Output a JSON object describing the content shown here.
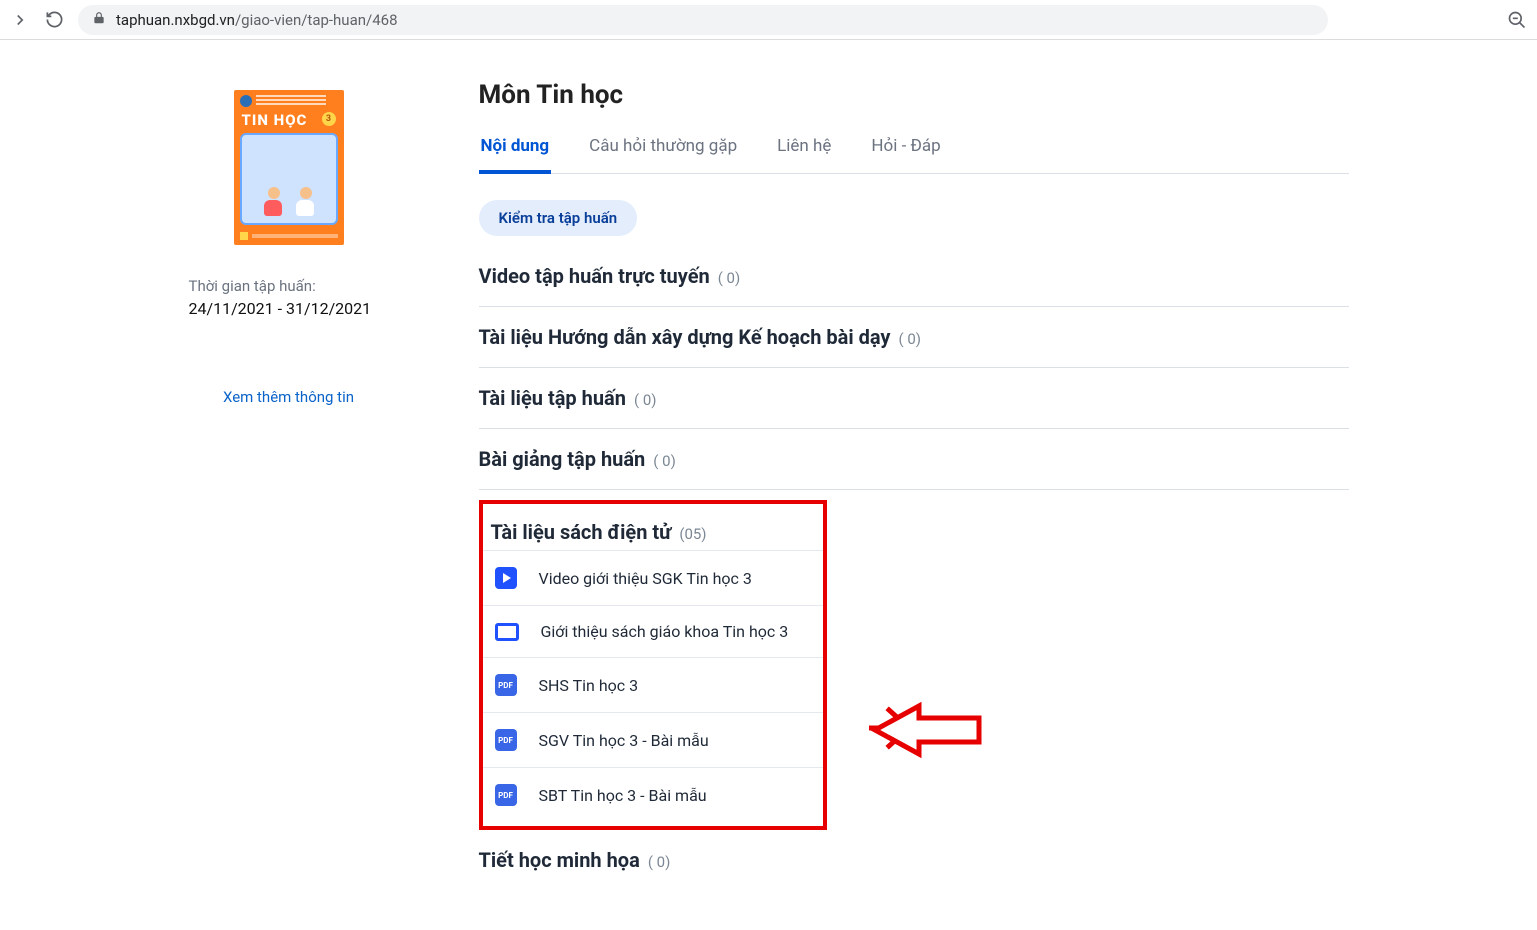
{
  "browser": {
    "url_host": "taphuan.nxbgd.vn",
    "url_path": "/giao-vien/tap-huan/468"
  },
  "cover": {
    "title": "TIN HỌC",
    "grade": "3"
  },
  "sidebar": {
    "time_label": "Thời gian tập huấn:",
    "time_value": "24/11/2021 - 31/12/2021",
    "more_link": "Xem thêm thông tin"
  },
  "header": {
    "title": "Môn Tin học"
  },
  "tabs": [
    {
      "label": "Nội dung",
      "active": true
    },
    {
      "label": "Câu hỏi thường gặp",
      "active": false
    },
    {
      "label": "Liên hệ",
      "active": false
    },
    {
      "label": "Hỏi - Đáp",
      "active": false
    }
  ],
  "chip": {
    "label": "Kiểm tra tập huấn"
  },
  "sections": [
    {
      "title": "Video tập huấn trực tuyến",
      "count": "( 0)"
    },
    {
      "title": "Tài liệu Hướng dẫn xây dựng Kế hoạch bài dạy",
      "count": "( 0)"
    },
    {
      "title": "Tài liệu tập huấn",
      "count": "( 0)"
    },
    {
      "title": "Bài giảng tập huấn",
      "count": "( 0)"
    }
  ],
  "ebook_section": {
    "title": "Tài liệu sách điện tử",
    "count": "(05)",
    "items": [
      {
        "icon": "video",
        "label": "Video giới thiệu SGK Tin học 3"
      },
      {
        "icon": "slide",
        "label": "Giới thiệu sách giáo khoa Tin học 3"
      },
      {
        "icon": "pdf",
        "pdf_text": "PDF",
        "label": "SHS Tin học 3"
      },
      {
        "icon": "pdf",
        "pdf_text": "PDF",
        "label": "SGV Tin học 3 - Bài mẫu"
      },
      {
        "icon": "pdf",
        "pdf_text": "PDF",
        "label": "SBT Tin học 3 - Bài mẫu"
      }
    ]
  },
  "footer_section": {
    "title": "Tiết học minh họa",
    "count": "( 0)"
  }
}
